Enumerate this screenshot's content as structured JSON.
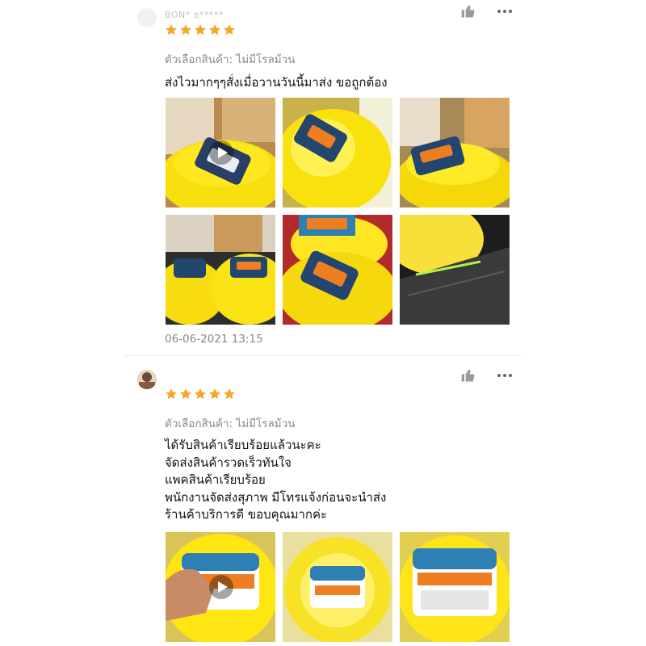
{
  "colors": {
    "star": "#f5a623",
    "text": "#111111",
    "muted": "#888888",
    "divider": "#e8e8e8"
  },
  "reviews": [
    {
      "username": "BON* ธ*****",
      "rating": 5,
      "variant": "ตัวเลือกสินค้า: ไม่มีโรลม้วน",
      "comment": "ส่งไวมากๆๆสั่งเมื่อวานวันนี้มาส่ง ขอถูกต้อง",
      "date": "06-06-2021 13:15",
      "media_count": 6,
      "has_video": true,
      "icons": {
        "like": "thumbs-up-icon",
        "more": "more-options-icon"
      }
    },
    {
      "username": "",
      "rating": 5,
      "variant": "ตัวเลือกสินค้า: ไม่มีโรลม้วน",
      "comment": "ได้รับสินค้าเรียบร้อยแล้วนะคะ\nจัดส่งสินค้ารวดเร็วทันใจ\nแพคสินค้าเรียบร้อย\nพนักงานจัดส่งสุภาพ มีโทรแจ้งก่อนจะนำส่ง\nร้านค้าบริการดี ขอบคุณมากค่ะ",
      "media_count": 3,
      "has_video": true,
      "icons": {
        "like": "thumbs-up-icon",
        "more": "more-options-icon"
      }
    }
  ]
}
